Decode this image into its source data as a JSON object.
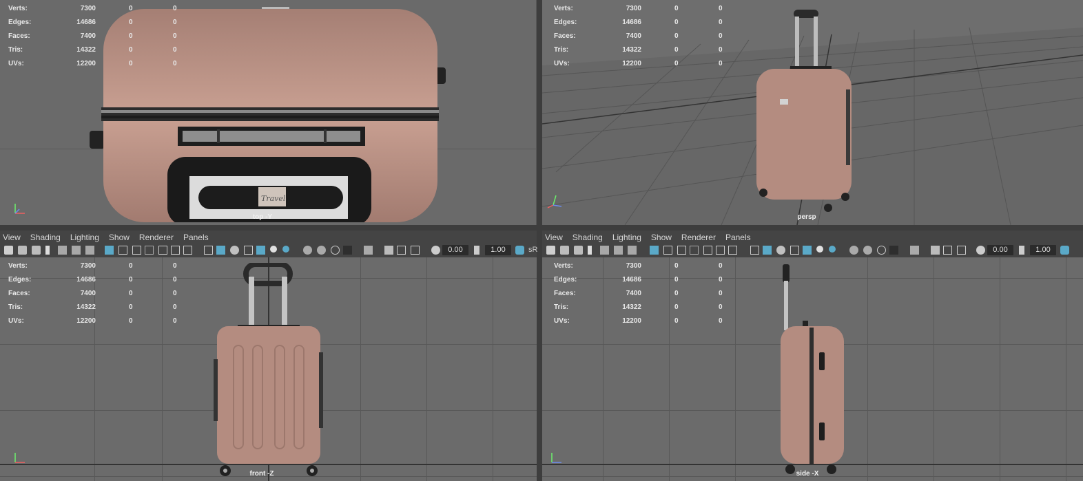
{
  "stats": [
    {
      "label": "Verts:",
      "value": "7300",
      "sel": "0",
      "extra": "0"
    },
    {
      "label": "Edges:",
      "value": "14686",
      "sel": "0",
      "extra": "0"
    },
    {
      "label": "Faces:",
      "value": "7400",
      "sel": "0",
      "extra": "0"
    },
    {
      "label": "Tris:",
      "value": "14322",
      "sel": "0",
      "extra": "0"
    },
    {
      "label": "UVs:",
      "value": "12200",
      "sel": "0",
      "extra": "0"
    }
  ],
  "viewports": {
    "top_left": {
      "camera": "top -Y"
    },
    "top_right": {
      "camera": "persp"
    },
    "bottom_left": {
      "camera": "front -Z"
    },
    "bottom_right": {
      "camera": "side -X"
    }
  },
  "menus": {
    "left": [
      "View",
      "Shading",
      "Lighting",
      "Show",
      "Renderer",
      "Panels"
    ],
    "right": [
      "View",
      "Shading",
      "Lighting",
      "Show",
      "Renderer",
      "Panels"
    ]
  },
  "toolbar": {
    "field_a": "0.00",
    "field_b": "1.00",
    "color_space_left": "sR"
  },
  "logo_text": "Travel",
  "colors": {
    "accent": "#5aa9c8",
    "suitcase": "#b48c80",
    "viewport_bg": "#6b6b6b"
  }
}
